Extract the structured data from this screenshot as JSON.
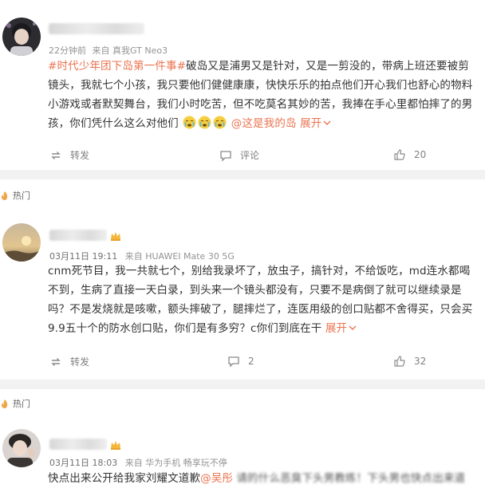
{
  "post1": {
    "meta_time": "22分钟前",
    "meta_source": "来自 真我GT Neo3",
    "hashtag": "#时代少年团下岛第一件事#",
    "body": "破岛又是浦男又是针对，又是一剪没的，带病上班还要被剪镜头，我就七个小孩，我只要他们健健康康，快快乐乐的拍点他们开心我们也舒心的物料小游戏或者默契舞台，我们小时吃苦，但不吃莫名其妙的苦，我捧在手心里都怕摔了的男孩，你们凭什么这么对他们",
    "mention": "@这是我的岛",
    "expand": "展开",
    "repost_label": "转发",
    "comment_label": "评论",
    "like_count": "20"
  },
  "section_label_1": "热门",
  "post2": {
    "date": "03月11日 19:11",
    "device": "来自 HUAWEI Mate 30 5G",
    "body": "cnm死节目，我一共就七个，别给我录坏了，放虫子，搞针对，不给饭吃，md连水都喝不到，生病了直接一天白录，到头来一个镜头都没有，只要不是病倒了就可以继续录是吗？不是发烧就是咳嗽，额头摔破了，腿摔烂了，连医用级的创口贴都不舍得买，只会买9.9五十个的防水创口贴，你们是有多穷？c你们到底在干",
    "expand": "展开",
    "repost_label": "转发",
    "comment_count": "2",
    "like_count": "32"
  },
  "section_label_2": "热门",
  "post3": {
    "date": "03月11日 18:03",
    "device": "来自 华为手机 畅享玩不停",
    "body_start": "快点出来公开给我家刘耀文道歉",
    "mention": "@吴彤",
    "body_end": " 请的什么恶臭下头男教练！下头男也快点出来道"
  },
  "colors": {
    "accent": "#eb7350",
    "text": "#333333",
    "meta": "#939393",
    "band": "#f2f2f2"
  },
  "icons": [
    "repost-icon",
    "comment-icon",
    "like-icon",
    "fire-icon",
    "crown-icon",
    "crying-emoji-icon",
    "chevron-down-icon"
  ]
}
